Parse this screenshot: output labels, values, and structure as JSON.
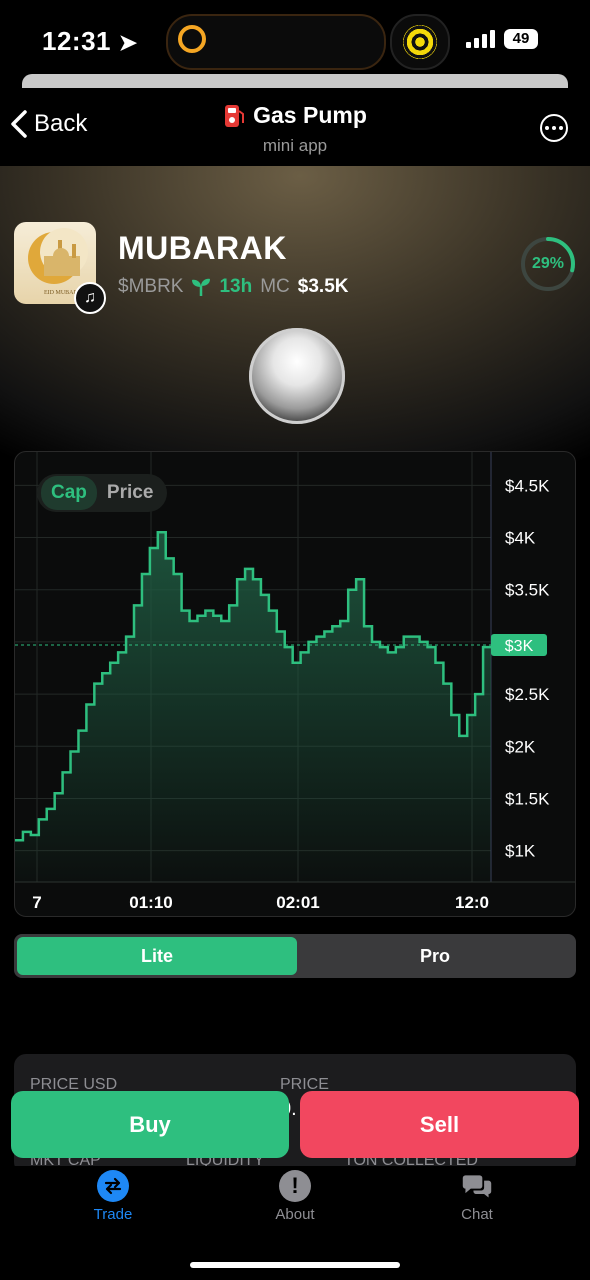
{
  "status": {
    "time": "12:31",
    "battery": "49"
  },
  "header": {
    "back_label": "Back",
    "title": "Gas Pump",
    "subtitle": "mini app"
  },
  "token": {
    "name": "MUBARAK",
    "image_text": "EID MUBARAK",
    "ticker": "$MBRK",
    "age": "13h",
    "mc_label": "MC",
    "mc_value": "$3.5K",
    "progress_label": "29%",
    "progress": 0.29
  },
  "chart": {
    "toggle": [
      "Cap",
      "Price"
    ],
    "active_toggle": "Cap",
    "current_label": "$3K",
    "colors": {
      "line": "#2ebf7f",
      "grid": "#232826",
      "fill_top": "#1f5a41"
    }
  },
  "chart_data": {
    "type": "area",
    "title": "",
    "xlabel": "",
    "ylabel": "",
    "x_tick_labels": [
      "7",
      "01:10",
      "02:01",
      "12:0"
    ],
    "y_tick_labels": [
      "$4.5K",
      "$4K",
      "$3.5K",
      "$3K",
      "$2.5K",
      "$2K",
      "$1.5K",
      "$1K"
    ],
    "ylim": [
      700,
      4800
    ],
    "current_value": 2970,
    "grid": true,
    "series": [
      {
        "values": [
          1100,
          1180,
          1150,
          1300,
          1400,
          1550,
          1750,
          1950,
          2150,
          2400,
          2600,
          2700,
          2800,
          2900,
          3050,
          3350,
          3650,
          3900,
          4050,
          3800,
          3650,
          3300,
          3200,
          3250,
          3300,
          3250,
          3200,
          3350,
          3600,
          3700,
          3600,
          3450,
          3300,
          3100,
          2950,
          2800,
          2900,
          3000,
          3050,
          3100,
          3150,
          3200,
          3500,
          3600,
          3150,
          3000,
          2950,
          2900,
          2950,
          3050,
          3050,
          3000,
          2950,
          2800,
          2600,
          2300,
          2100,
          2300,
          2500,
          2950
        ]
      }
    ]
  },
  "modes": {
    "lite": "Lite",
    "pro": "Pro",
    "active": "Lite"
  },
  "stats": {
    "price_usd_label": "PRICE USD",
    "price_label": "PRICE",
    "price_value_partial": "0.",
    "mkt_cap_label": "MKT CAP",
    "liquidity_label": "LIQUIDITY",
    "ton_collected_label": "TON COLLECTED"
  },
  "actions": {
    "buy": "Buy",
    "sell": "Sell"
  },
  "tabs": [
    {
      "label": "Trade",
      "icon": "swap-icon",
      "active": true
    },
    {
      "label": "About",
      "icon": "info-icon",
      "active": false
    },
    {
      "label": "Chat",
      "icon": "chat-icon",
      "active": false
    }
  ]
}
